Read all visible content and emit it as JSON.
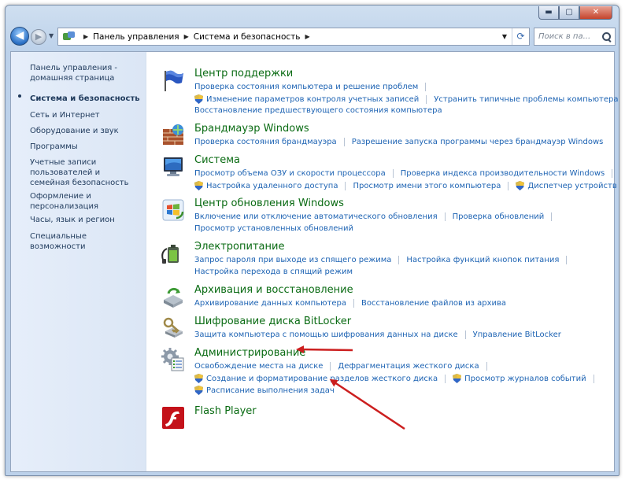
{
  "window": {
    "caption_buttons": {
      "minimize": "▬",
      "maximize": "▢",
      "close": "✕"
    }
  },
  "navbar": {
    "back_glyph": "◀",
    "forward_glyph": "▶",
    "history_dropdown": "▼",
    "breadcrumb": [
      "Панель управления",
      "Система и безопасность"
    ],
    "crumb_separator": "▶",
    "address_dropdown": "▼",
    "refresh_glyph": "⟳",
    "search_placeholder": "Поиск в па..."
  },
  "sidebar": {
    "home_link": "Панель управления - домашняя страница",
    "items": [
      {
        "label": "Система и безопасность",
        "active": true
      },
      {
        "label": "Сеть и Интернет"
      },
      {
        "label": "Оборудование и звук"
      },
      {
        "label": "Программы"
      },
      {
        "label": "Учетные записи пользователей и семейная безопасность"
      },
      {
        "label": "Оформление и персонализация"
      },
      {
        "label": "Часы, язык и регион"
      },
      {
        "label": "Специальные возможности"
      }
    ]
  },
  "categories": [
    {
      "title": "Центр поддержки",
      "icon": "flag-icon",
      "rows": [
        [
          "Проверка состояния компьютера и решение проблем"
        ],
        [
          "Изменение параметров контроля учетных записей",
          "Устранить типичные проблемы компьютера"
        ],
        [
          "Восстановление предшествующего состояния компьютера"
        ]
      ]
    },
    {
      "title": "Брандмауэр Windows",
      "icon": "firewall-icon",
      "rows": [
        [
          "Проверка состояния брандмауэра",
          "Разрешение запуска программы через брандмауэр Windows"
        ]
      ]
    },
    {
      "title": "Система",
      "icon": "system-icon",
      "rows": [
        [
          "Просмотр объема ОЗУ и скорости процессора",
          "Проверка индекса производительности Windows"
        ],
        [
          "Настройка удаленного доступа",
          "Просмотр имени этого компьютера",
          "Диспетчер устройств"
        ]
      ]
    },
    {
      "title": "Центр обновления Windows",
      "icon": "windows-update-icon",
      "rows": [
        [
          "Включение или отключение автоматического обновления",
          "Проверка обновлений"
        ],
        [
          "Просмотр установленных обновлений"
        ]
      ]
    },
    {
      "title": "Электропитание",
      "icon": "power-icon",
      "rows": [
        [
          "Запрос пароля при выходе из спящего режима",
          "Настройка функций кнопок питания"
        ],
        [
          "Настройка перехода в спящий режим"
        ]
      ]
    },
    {
      "title": "Архивация и восстановление",
      "icon": "backup-icon",
      "rows": [
        [
          "Архивирование данных компьютера",
          "Восстановление файлов из архива"
        ]
      ]
    },
    {
      "title": "Шифрование диска BitLocker",
      "icon": "bitlocker-icon",
      "rows": [
        [
          "Защита компьютера с помощью шифрования данных на диске",
          "Управление BitLocker"
        ]
      ]
    },
    {
      "title": "Администрирование",
      "icon": "admin-tools-icon",
      "rows": [
        [
          "Освобождение места на диске",
          "Дефрагментация жесткого диска"
        ],
        [
          "Создание и форматирование разделов жесткого диска",
          "Просмотр журналов событий"
        ],
        [
          "Расписание выполнения задач"
        ]
      ]
    },
    {
      "title": "Flash Player",
      "icon": "flash-player-icon",
      "rows": []
    }
  ],
  "accent": {
    "title_green": "#0a6b13",
    "link_blue": "#1d63b3",
    "arrow_red": "#cc1f1f"
  }
}
